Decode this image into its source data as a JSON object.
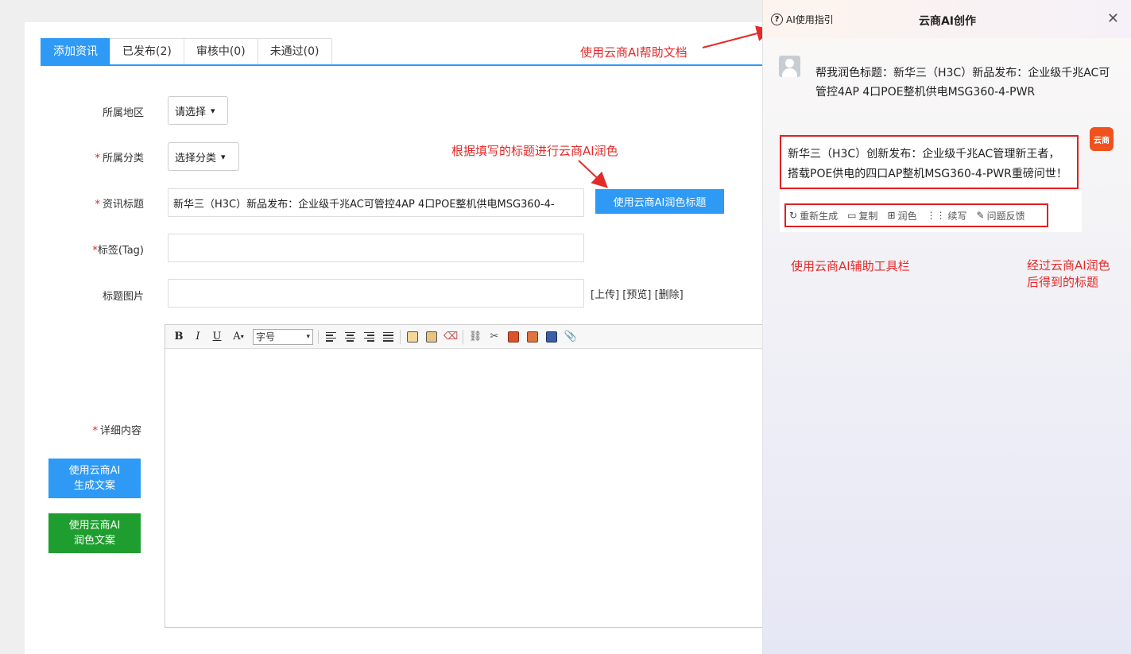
{
  "tabs": [
    {
      "label": "添加资讯"
    },
    {
      "label": "已发布(2)"
    },
    {
      "label": "审核中(0)"
    },
    {
      "label": "未通过(0)"
    }
  ],
  "form": {
    "region_label": "所属地区",
    "region_value": "请选择",
    "category_label": "所属分类",
    "category_value": "选择分类",
    "title_label": "资讯标题",
    "title_value": "新华三（H3C）新品发布：企业级千兆AC可管控4AP 4口POE整机供电MSG360-4-",
    "polish_title_button": "使用云商AI润色标题",
    "tag_label": "*标签(Tag)",
    "image_label": "标题图片",
    "image_links": [
      "[上传]",
      "[预览]",
      "[删除]"
    ],
    "content_label": "详细内容",
    "gen_button_line1": "使用云商AI",
    "gen_button_line2": "生成文案",
    "polish_button_line1": "使用云商AI",
    "polish_button_line2": "润色文案"
  },
  "editor": {
    "font_size_select": "字号",
    "toolbar_icons": [
      "bold-icon",
      "italic-icon",
      "underline-icon",
      "font-color-icon",
      "align-left-icon",
      "align-center-icon",
      "align-right-icon",
      "align-justify-icon",
      "paste-icon",
      "paste-text-icon",
      "clear-format-icon",
      "link-icon",
      "unlink-icon",
      "image-icon",
      "multi-image-icon",
      "video-icon",
      "attachment-icon"
    ]
  },
  "annotations": {
    "help_doc": "使用云商AI帮助文档",
    "polish_by_title": "根据填写的标题进行云商AI润色",
    "toolbar": "使用云商AI辅助工具栏",
    "result_line1": "经过云商AI润色",
    "result_line2": "后得到的标题"
  },
  "panel": {
    "guide": "AI使用指引",
    "title": "云商AI创作",
    "user_message": "帮我润色标题：新华三（H3C）新品发布：企业级千兆AC可管控4AP 4口POE整机供电MSG360-4-PWR",
    "logo_text": "云商",
    "ai_reply": "新华三（H3C）创新发布：企业级千兆AC管理新王者，搭载POE供电的四口AP整机MSG360-4-PWR重磅问世！",
    "tools": [
      {
        "label": "重新生成",
        "icon": "refresh-icon"
      },
      {
        "label": "复制",
        "icon": "copy-icon"
      },
      {
        "label": "润色",
        "icon": "book-icon"
      },
      {
        "label": "续写",
        "icon": "continue-icon"
      },
      {
        "label": "问题反馈",
        "icon": "feedback-icon"
      }
    ]
  },
  "colors": {
    "accent_blue": "#2e9af5",
    "green": "#1e9e2e",
    "annotation_red": "#e52a2a",
    "logo_orange": "#f0521e"
  }
}
